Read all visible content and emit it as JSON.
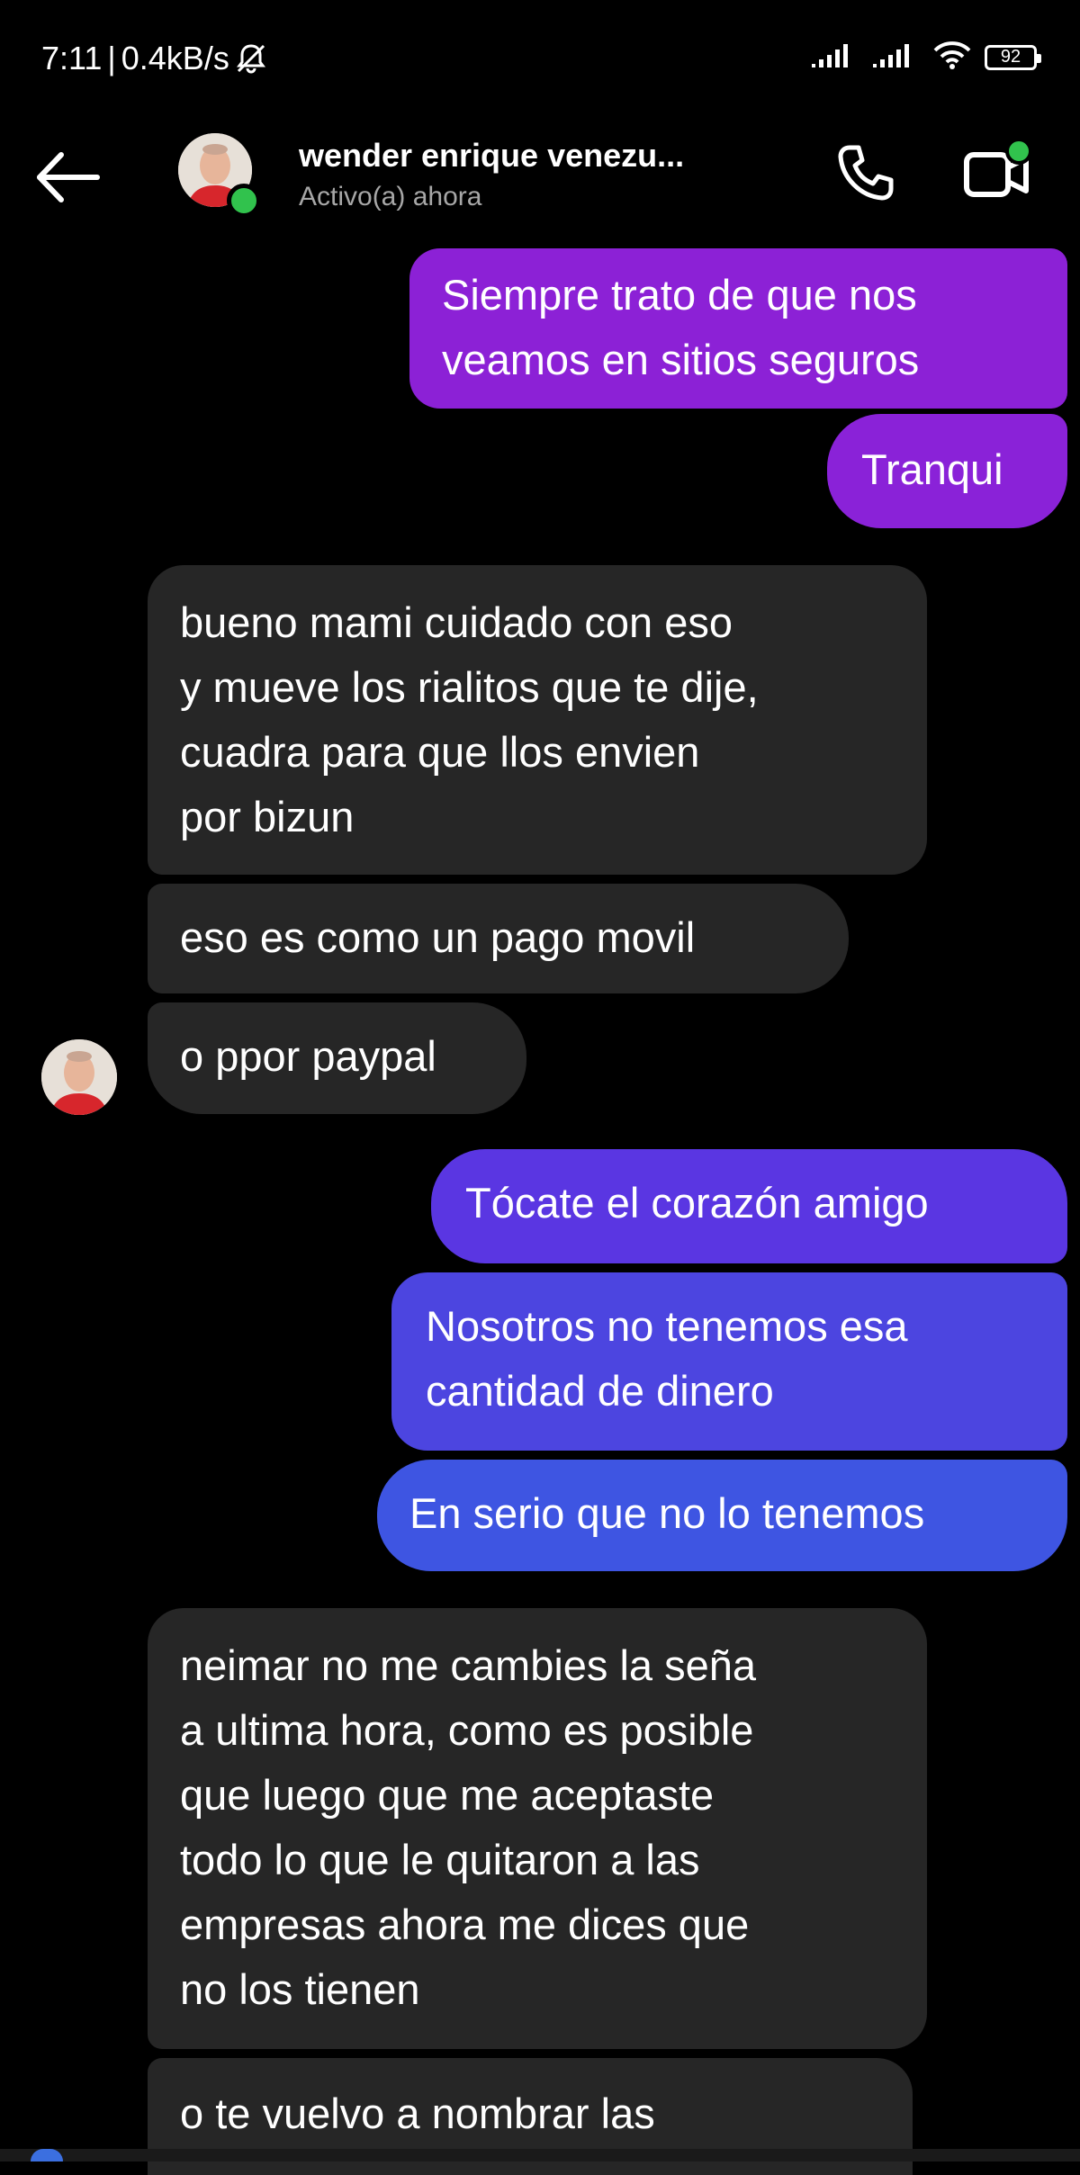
{
  "status_bar": {
    "time": "7:11",
    "separator": "|",
    "speed": "0.4kB/s",
    "battery": "92",
    "icons": [
      "bell-off-icon",
      "signal-icon",
      "signal-icon",
      "wifi-icon",
      "battery-icon"
    ]
  },
  "header": {
    "back_icon": "arrow-left-icon",
    "contact_name": "wender enrique venezu...",
    "contact_status": "Activo(a) ahora",
    "call_icon": "phone-icon",
    "video_icon": "video-camera-icon",
    "online_color": "#31c24d"
  },
  "messages": [
    {
      "from": "me",
      "lines": [
        "Siempre trato de que nos",
        "veamos en sitios seguros"
      ],
      "color": "#8c21d6"
    },
    {
      "from": "me",
      "lines": [
        "Tranqui"
      ],
      "color": "#8a22d8"
    },
    {
      "from": "them",
      "lines": [
        "bueno mami cuidado con eso",
        "y mueve los rialitos que te dije,",
        "cuadra para que llos envien",
        "por bizun"
      ]
    },
    {
      "from": "them",
      "lines": [
        "eso es como un pago movil"
      ]
    },
    {
      "from": "them",
      "lines": [
        "o ppor paypal"
      ]
    },
    {
      "from": "me",
      "lines": [
        "Tócate el corazón amigo"
      ],
      "color": "#5a36e2"
    },
    {
      "from": "me",
      "lines": [
        "Nosotros no tenemos esa",
        "cantidad de dinero"
      ],
      "color": "#4c45e0"
    },
    {
      "from": "me",
      "lines": [
        "En serio que no lo tenemos"
      ],
      "color": "#3e55e2"
    },
    {
      "from": "them",
      "lines": [
        "neimar no me cambies la seña",
        "a ultima hora, como es posible",
        "que luego que me aceptaste",
        "todo lo que le quitaron a las",
        "empresas ahora me dices que",
        "no los tienen"
      ]
    },
    {
      "from": "them",
      "lines": [
        "o te vuelvo a nombrar las"
      ]
    }
  ],
  "colors": {
    "background": "#000000",
    "incoming_bubble": "#262626"
  }
}
